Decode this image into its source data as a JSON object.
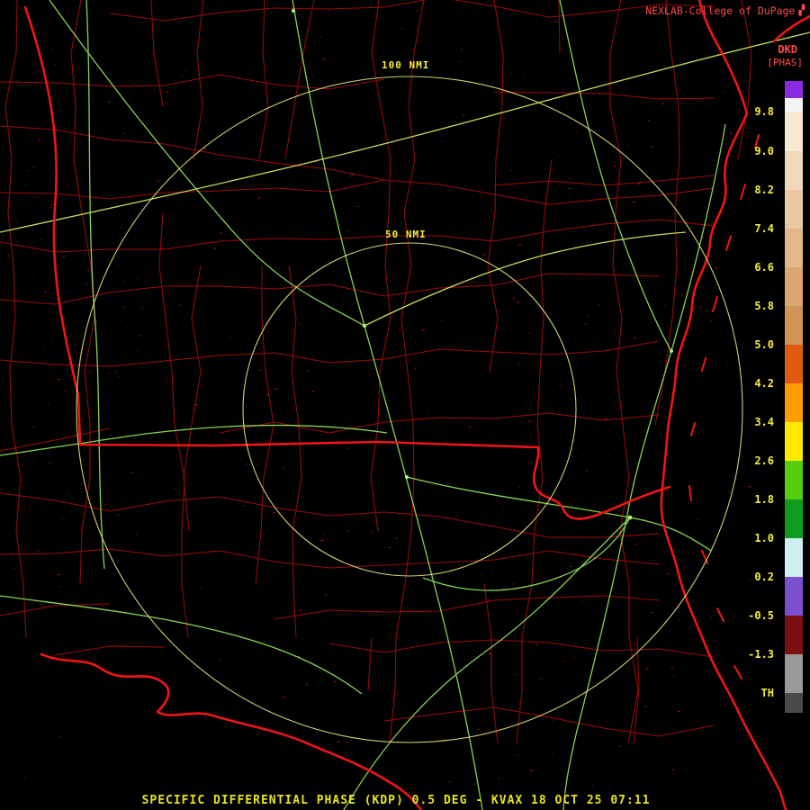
{
  "header": {
    "brand": "NEXLAB-College of DuPage",
    "logo_glyph": "▞",
    "product_code": "DKD",
    "product_tag": "[PHAS]"
  },
  "rings": {
    "outer_label": "100 NMI",
    "inner_label": "50 NMI"
  },
  "caption": {
    "text": "SPECIFIC DIFFERENTIAL PHASE (KDP) 0.5 DEG - KVAX 18 OCT 25 07:11",
    "product": "SPECIFIC DIFFERENTIAL PHASE (KDP)",
    "elevation": "0.5 DEG",
    "station": "KVAX",
    "datetime": "18 OCT 25 07:11"
  },
  "colorbar": {
    "labels": [
      "9.8",
      "9.0",
      "8.2",
      "7.4",
      "6.6",
      "5.8",
      "5.0",
      "4.2",
      "3.4",
      "2.6",
      "1.8",
      "1.0",
      "0.2",
      "-0.5",
      "-1.3"
    ],
    "threshold_label": "TH",
    "bands": [
      {
        "name": "top-purple",
        "color": "#8a2be2",
        "span": 0.45
      },
      {
        "name": "top-white",
        "color": "#f4f4f4",
        "span": 0.35
      },
      {
        "name": "9.8-9.0",
        "color": "#f6e8d2",
        "span": 1
      },
      {
        "name": "9.0-8.2",
        "color": "#f0d9ba",
        "span": 1
      },
      {
        "name": "8.2-7.4",
        "color": "#eac9a1",
        "span": 1
      },
      {
        "name": "7.4-6.6",
        "color": "#e3b888",
        "span": 1
      },
      {
        "name": "6.6-5.8",
        "color": "#dba76f",
        "span": 1
      },
      {
        "name": "5.8-5.0",
        "color": "#d19356",
        "span": 1
      },
      {
        "name": "5.0-4.2",
        "color": "#e05a10",
        "span": 1
      },
      {
        "name": "4.2-3.4",
        "color": "#ff9c00",
        "span": 1
      },
      {
        "name": "3.4-2.6",
        "color": "#ffe900",
        "span": 1
      },
      {
        "name": "2.6-1.8",
        "color": "#56cc0e",
        "span": 1
      },
      {
        "name": "1.8-1.0",
        "color": "#0f9c1e",
        "span": 1
      },
      {
        "name": "1.0-0.2",
        "color": "#cfeef0",
        "span": 1
      },
      {
        "name": "0.2--0.5",
        "color": "#7a4fd0",
        "span": 1
      },
      {
        "name": "-0.5--1.3",
        "color": "#7a1010",
        "span": 1
      },
      {
        "name": "-1.3-TH",
        "color": "#999999",
        "span": 1
      },
      {
        "name": "below-TH",
        "color": "#4a4a4a",
        "span": 0.5
      }
    ]
  },
  "map_style": {
    "county_color": "#b30d0d",
    "state_color": "#f01515",
    "highway_color": "#8fe05a",
    "highway_alt_color": "#d2e860",
    "city_dot_color": "#aef07a",
    "ring_color": "#e9e97e",
    "speck_color": "#c01616",
    "label_yellow": "#f4ec3e",
    "caption_yellow": "#e8e41c",
    "brand_red": "#ff4848",
    "background": "#000000"
  }
}
